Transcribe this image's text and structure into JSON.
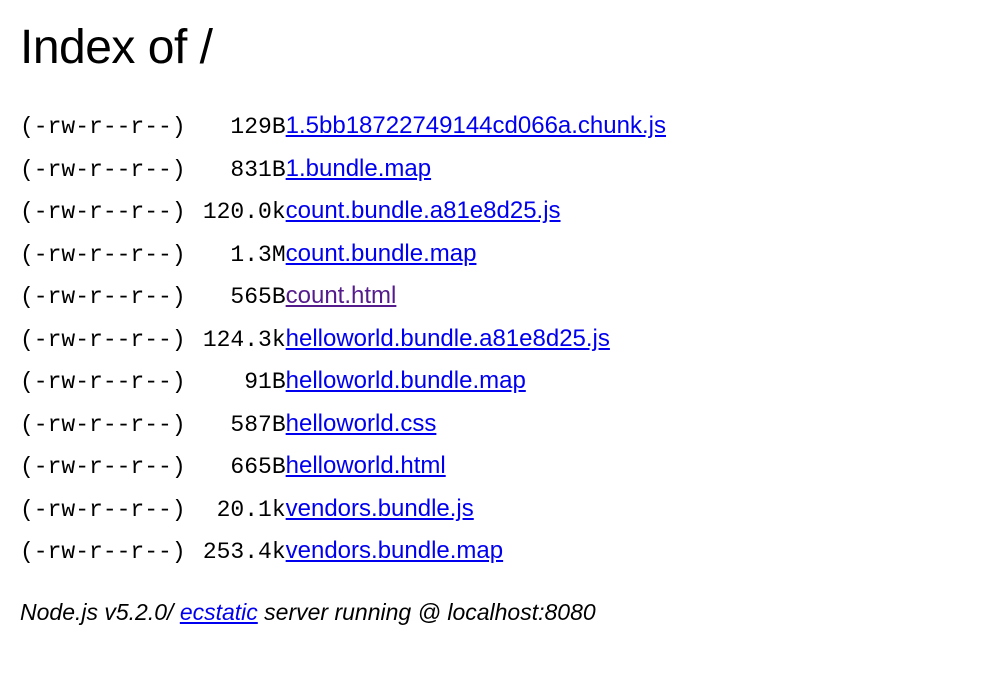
{
  "title": "Index of /",
  "files": [
    {
      "perm": "(-rw-r--r--)",
      "size": "129B",
      "name": "1.5bb18722749144cd066a.chunk.js",
      "visited": false
    },
    {
      "perm": "(-rw-r--r--)",
      "size": "831B",
      "name": "1.bundle.map",
      "visited": false
    },
    {
      "perm": "(-rw-r--r--)",
      "size": "120.0k",
      "name": "count.bundle.a81e8d25.js",
      "visited": false
    },
    {
      "perm": "(-rw-r--r--)",
      "size": "1.3M",
      "name": "count.bundle.map",
      "visited": false
    },
    {
      "perm": "(-rw-r--r--)",
      "size": "565B",
      "name": "count.html",
      "visited": true
    },
    {
      "perm": "(-rw-r--r--)",
      "size": "124.3k",
      "name": "helloworld.bundle.a81e8d25.js",
      "visited": false
    },
    {
      "perm": "(-rw-r--r--)",
      "size": "91B",
      "name": "helloworld.bundle.map",
      "visited": false
    },
    {
      "perm": "(-rw-r--r--)",
      "size": "587B",
      "name": "helloworld.css",
      "visited": false
    },
    {
      "perm": "(-rw-r--r--)",
      "size": "665B",
      "name": "helloworld.html",
      "visited": false
    },
    {
      "perm": "(-rw-r--r--)",
      "size": "20.1k",
      "name": "vendors.bundle.js",
      "visited": false
    },
    {
      "perm": "(-rw-r--r--)",
      "size": "253.4k",
      "name": "vendors.bundle.map",
      "visited": false
    }
  ],
  "footer": {
    "prefix": "Node.js v5.2.0/ ",
    "link_text": "ecstatic",
    "suffix": " server running @ localhost:8080"
  }
}
